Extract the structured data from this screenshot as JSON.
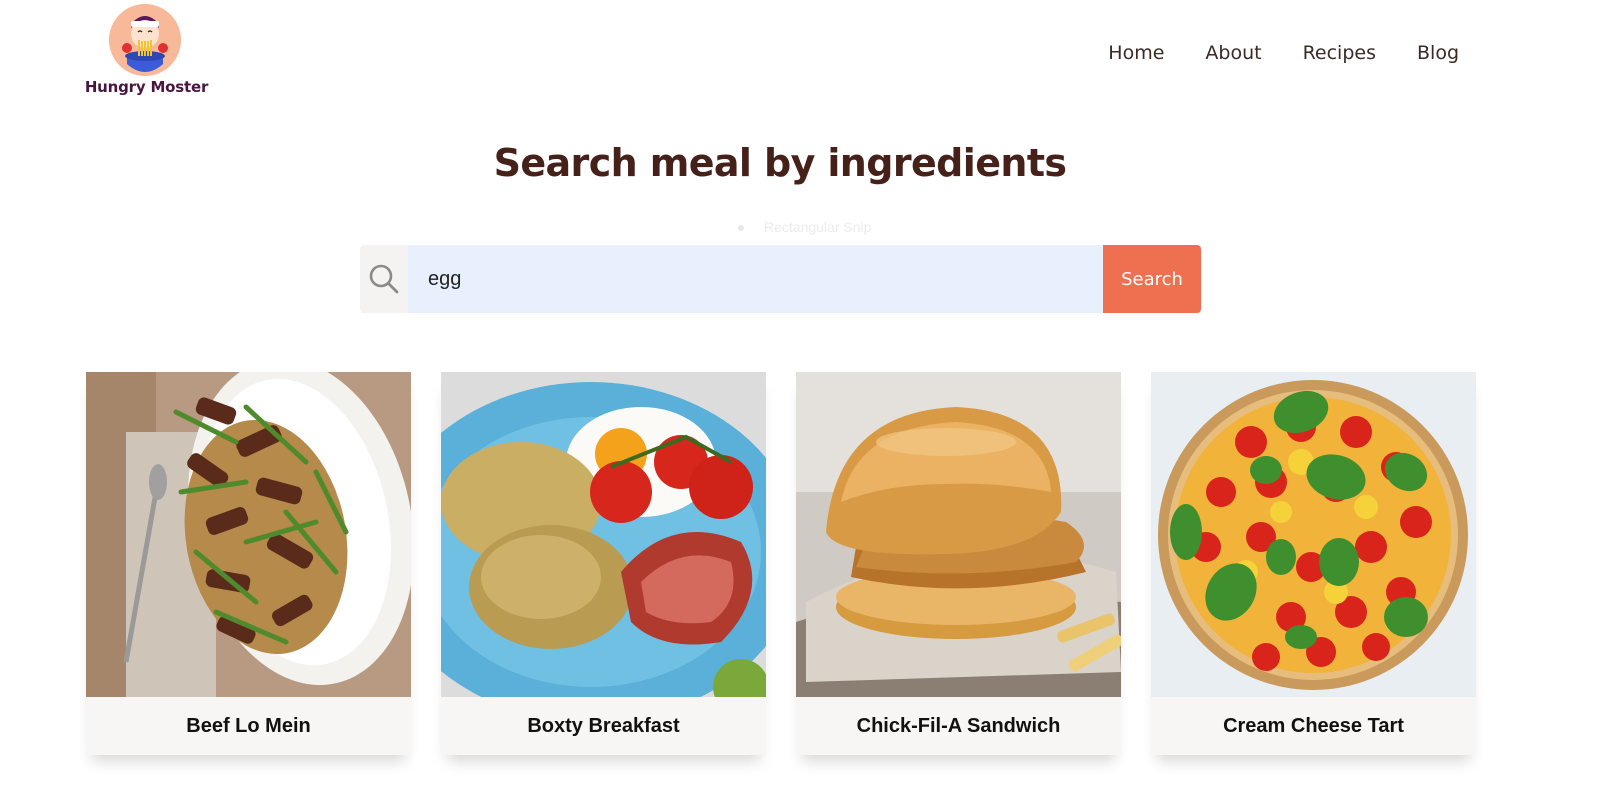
{
  "brand": {
    "name": "Hungry Moster"
  },
  "nav": {
    "items": [
      "Home",
      "About",
      "Recipes",
      "Blog"
    ]
  },
  "page": {
    "title": "Search meal by ingredients",
    "ghost_text": "Rectangular Snip"
  },
  "search": {
    "value": "egg",
    "button_label": "Search",
    "icon": "search-icon"
  },
  "meals": [
    {
      "name": "Beef Lo Mein"
    },
    {
      "name": "Boxty Breakfast"
    },
    {
      "name": "Chick-Fil-A Sandwich"
    },
    {
      "name": "Cream Cheese Tart"
    }
  ],
  "colors": {
    "accent": "#ef6f51",
    "title": "#45211a",
    "brand": "#4a1640",
    "input_bg": "#e8f0fe"
  }
}
